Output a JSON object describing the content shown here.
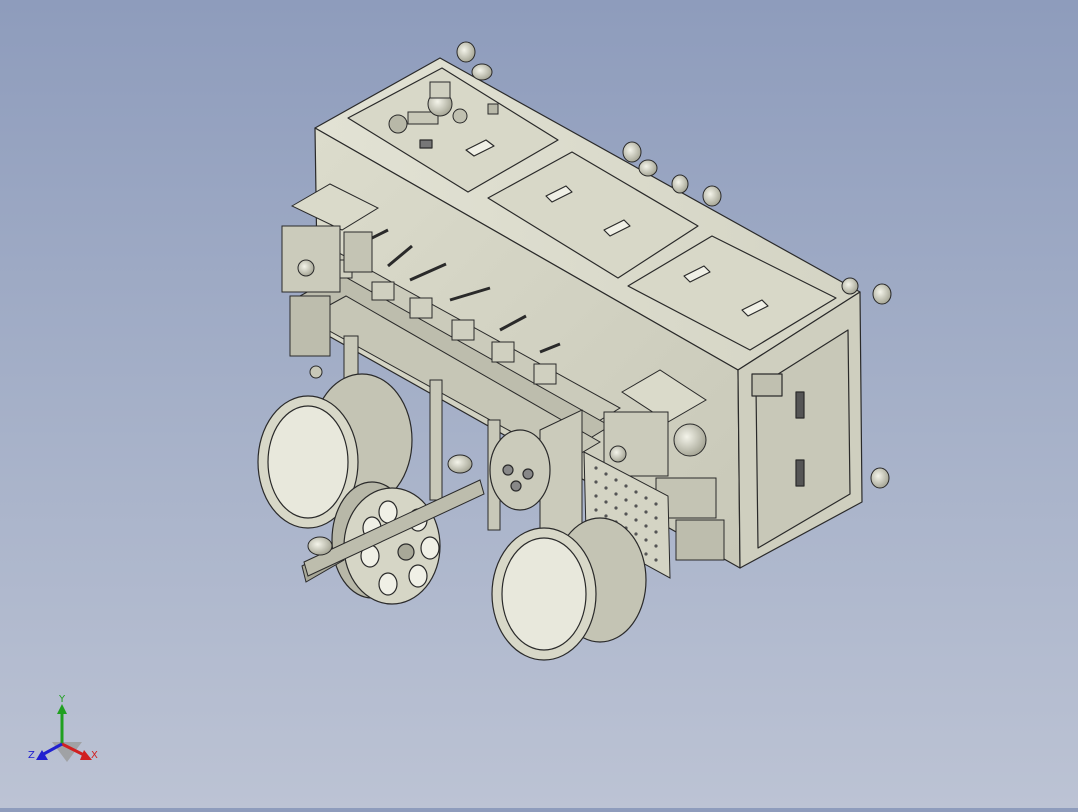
{
  "viewport": {
    "background_top": "#8e9cbc",
    "background_bottom": "#bcc3d4",
    "model_color": "#d6d6c6",
    "model_shadow": "#a8a898",
    "edge_color": "#2a2a2a"
  },
  "triad": {
    "x_label": "X",
    "y_label": "Y",
    "z_label": "Z",
    "x_color": "#d02020",
    "y_color": "#20a020",
    "z_color": "#2020d0"
  }
}
